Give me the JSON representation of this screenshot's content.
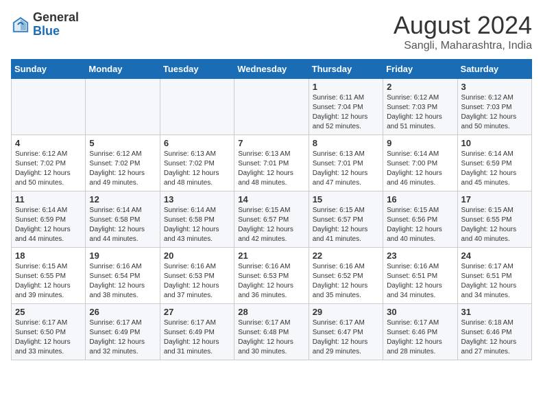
{
  "header": {
    "logo_general": "General",
    "logo_blue": "Blue",
    "month_year": "August 2024",
    "location": "Sangli, Maharashtra, India"
  },
  "weekdays": [
    "Sunday",
    "Monday",
    "Tuesday",
    "Wednesday",
    "Thursday",
    "Friday",
    "Saturday"
  ],
  "weeks": [
    [
      {
        "day": "",
        "info": ""
      },
      {
        "day": "",
        "info": ""
      },
      {
        "day": "",
        "info": ""
      },
      {
        "day": "",
        "info": ""
      },
      {
        "day": "1",
        "info": "Sunrise: 6:11 AM\nSunset: 7:04 PM\nDaylight: 12 hours\nand 52 minutes."
      },
      {
        "day": "2",
        "info": "Sunrise: 6:12 AM\nSunset: 7:03 PM\nDaylight: 12 hours\nand 51 minutes."
      },
      {
        "day": "3",
        "info": "Sunrise: 6:12 AM\nSunset: 7:03 PM\nDaylight: 12 hours\nand 50 minutes."
      }
    ],
    [
      {
        "day": "4",
        "info": "Sunrise: 6:12 AM\nSunset: 7:02 PM\nDaylight: 12 hours\nand 50 minutes."
      },
      {
        "day": "5",
        "info": "Sunrise: 6:12 AM\nSunset: 7:02 PM\nDaylight: 12 hours\nand 49 minutes."
      },
      {
        "day": "6",
        "info": "Sunrise: 6:13 AM\nSunset: 7:02 PM\nDaylight: 12 hours\nand 48 minutes."
      },
      {
        "day": "7",
        "info": "Sunrise: 6:13 AM\nSunset: 7:01 PM\nDaylight: 12 hours\nand 48 minutes."
      },
      {
        "day": "8",
        "info": "Sunrise: 6:13 AM\nSunset: 7:01 PM\nDaylight: 12 hours\nand 47 minutes."
      },
      {
        "day": "9",
        "info": "Sunrise: 6:14 AM\nSunset: 7:00 PM\nDaylight: 12 hours\nand 46 minutes."
      },
      {
        "day": "10",
        "info": "Sunrise: 6:14 AM\nSunset: 6:59 PM\nDaylight: 12 hours\nand 45 minutes."
      }
    ],
    [
      {
        "day": "11",
        "info": "Sunrise: 6:14 AM\nSunset: 6:59 PM\nDaylight: 12 hours\nand 44 minutes."
      },
      {
        "day": "12",
        "info": "Sunrise: 6:14 AM\nSunset: 6:58 PM\nDaylight: 12 hours\nand 44 minutes."
      },
      {
        "day": "13",
        "info": "Sunrise: 6:14 AM\nSunset: 6:58 PM\nDaylight: 12 hours\nand 43 minutes."
      },
      {
        "day": "14",
        "info": "Sunrise: 6:15 AM\nSunset: 6:57 PM\nDaylight: 12 hours\nand 42 minutes."
      },
      {
        "day": "15",
        "info": "Sunrise: 6:15 AM\nSunset: 6:57 PM\nDaylight: 12 hours\nand 41 minutes."
      },
      {
        "day": "16",
        "info": "Sunrise: 6:15 AM\nSunset: 6:56 PM\nDaylight: 12 hours\nand 40 minutes."
      },
      {
        "day": "17",
        "info": "Sunrise: 6:15 AM\nSunset: 6:55 PM\nDaylight: 12 hours\nand 40 minutes."
      }
    ],
    [
      {
        "day": "18",
        "info": "Sunrise: 6:15 AM\nSunset: 6:55 PM\nDaylight: 12 hours\nand 39 minutes."
      },
      {
        "day": "19",
        "info": "Sunrise: 6:16 AM\nSunset: 6:54 PM\nDaylight: 12 hours\nand 38 minutes."
      },
      {
        "day": "20",
        "info": "Sunrise: 6:16 AM\nSunset: 6:53 PM\nDaylight: 12 hours\nand 37 minutes."
      },
      {
        "day": "21",
        "info": "Sunrise: 6:16 AM\nSunset: 6:53 PM\nDaylight: 12 hours\nand 36 minutes."
      },
      {
        "day": "22",
        "info": "Sunrise: 6:16 AM\nSunset: 6:52 PM\nDaylight: 12 hours\nand 35 minutes."
      },
      {
        "day": "23",
        "info": "Sunrise: 6:16 AM\nSunset: 6:51 PM\nDaylight: 12 hours\nand 34 minutes."
      },
      {
        "day": "24",
        "info": "Sunrise: 6:17 AM\nSunset: 6:51 PM\nDaylight: 12 hours\nand 34 minutes."
      }
    ],
    [
      {
        "day": "25",
        "info": "Sunrise: 6:17 AM\nSunset: 6:50 PM\nDaylight: 12 hours\nand 33 minutes."
      },
      {
        "day": "26",
        "info": "Sunrise: 6:17 AM\nSunset: 6:49 PM\nDaylight: 12 hours\nand 32 minutes."
      },
      {
        "day": "27",
        "info": "Sunrise: 6:17 AM\nSunset: 6:49 PM\nDaylight: 12 hours\nand 31 minutes."
      },
      {
        "day": "28",
        "info": "Sunrise: 6:17 AM\nSunset: 6:48 PM\nDaylight: 12 hours\nand 30 minutes."
      },
      {
        "day": "29",
        "info": "Sunrise: 6:17 AM\nSunset: 6:47 PM\nDaylight: 12 hours\nand 29 minutes."
      },
      {
        "day": "30",
        "info": "Sunrise: 6:17 AM\nSunset: 6:46 PM\nDaylight: 12 hours\nand 28 minutes."
      },
      {
        "day": "31",
        "info": "Sunrise: 6:18 AM\nSunset: 6:46 PM\nDaylight: 12 hours\nand 27 minutes."
      }
    ]
  ]
}
